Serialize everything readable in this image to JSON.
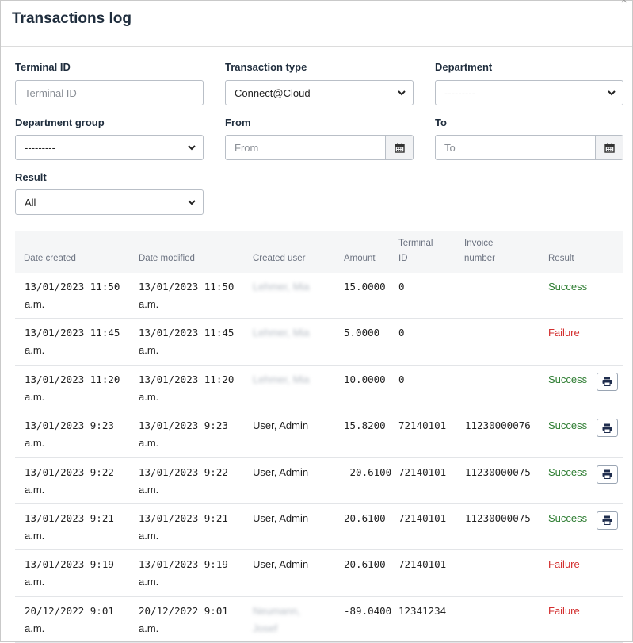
{
  "modal": {
    "title": "Transactions log",
    "close_symbol": "×"
  },
  "filters": {
    "terminal_id": {
      "label": "Terminal ID",
      "placeholder": "Terminal ID",
      "value": ""
    },
    "transaction_type": {
      "label": "Transaction type",
      "value": "Connect@Cloud"
    },
    "department": {
      "label": "Department",
      "value": "---------"
    },
    "department_group": {
      "label": "Department group",
      "value": "---------"
    },
    "from": {
      "label": "From",
      "placeholder": "From",
      "value": ""
    },
    "to": {
      "label": "To",
      "placeholder": "To",
      "value": ""
    },
    "result": {
      "label": "Result",
      "value": "All"
    }
  },
  "table": {
    "headers": {
      "date_created": "Date created",
      "date_modified": "Date modified",
      "created_user": "Created user",
      "amount": "Amount",
      "terminal_id_1": "Terminal",
      "terminal_id_2": "ID",
      "invoice_number_1": "Invoice",
      "invoice_number_2": "number",
      "result": "Result"
    },
    "rows": [
      {
        "created_1": "13/01/2023 11:50",
        "created_2": "a.m.",
        "modified_1": "13/01/2023 11:50",
        "modified_2": "a.m.",
        "user_1": "Lehmer, Mia",
        "user_2": "",
        "user_blurred": true,
        "amount": "15.0000",
        "terminal": "0",
        "invoice": "",
        "result": "Success",
        "status": "success",
        "printable": false
      },
      {
        "created_1": "13/01/2023 11:45",
        "created_2": "a.m.",
        "modified_1": "13/01/2023 11:45",
        "modified_2": "a.m.",
        "user_1": "Lehmer, Mia",
        "user_2": "",
        "user_blurred": true,
        "amount": "5.0000",
        "terminal": "0",
        "invoice": "",
        "result": "Failure",
        "status": "failure",
        "printable": false
      },
      {
        "created_1": "13/01/2023 11:20",
        "created_2": "a.m.",
        "modified_1": "13/01/2023 11:20",
        "modified_2": "a.m.",
        "user_1": "Lehmer, Mia",
        "user_2": "",
        "user_blurred": true,
        "amount": "10.0000",
        "terminal": "0",
        "invoice": "",
        "result": "Success",
        "status": "success",
        "printable": true
      },
      {
        "created_1": "13/01/2023 9:23",
        "created_2": "a.m.",
        "modified_1": "13/01/2023 9:23",
        "modified_2": "a.m.",
        "user_1": "User, Admin",
        "user_2": "",
        "user_blurred": false,
        "amount": "15.8200",
        "terminal": "72140101",
        "invoice": "11230000076",
        "result": "Success",
        "status": "success",
        "printable": true
      },
      {
        "created_1": "13/01/2023 9:22",
        "created_2": "a.m.",
        "modified_1": "13/01/2023 9:22",
        "modified_2": "a.m.",
        "user_1": "User, Admin",
        "user_2": "",
        "user_blurred": false,
        "amount": "-20.6100",
        "terminal": "72140101",
        "invoice": "11230000075",
        "result": "Success",
        "status": "success",
        "printable": true
      },
      {
        "created_1": "13/01/2023 9:21",
        "created_2": "a.m.",
        "modified_1": "13/01/2023 9:21",
        "modified_2": "a.m.",
        "user_1": "User, Admin",
        "user_2": "",
        "user_blurred": false,
        "amount": "20.6100",
        "terminal": "72140101",
        "invoice": "11230000075",
        "result": "Success",
        "status": "success",
        "printable": true
      },
      {
        "created_1": "13/01/2023 9:19",
        "created_2": "a.m.",
        "modified_1": "13/01/2023 9:19",
        "modified_2": "a.m.",
        "user_1": "User, Admin",
        "user_2": "",
        "user_blurred": false,
        "amount": "20.6100",
        "terminal": "72140101",
        "invoice": "",
        "result": "Failure",
        "status": "failure",
        "printable": false
      },
      {
        "created_1": "20/12/2022 9:01",
        "created_2": "a.m.",
        "modified_1": "20/12/2022 9:01",
        "modified_2": "a.m.",
        "user_1": "Neumann,",
        "user_2": "Josef",
        "user_blurred": true,
        "amount": "-89.0400",
        "terminal": "12341234",
        "invoice": "",
        "result": "Failure",
        "status": "failure",
        "printable": false
      }
    ]
  }
}
